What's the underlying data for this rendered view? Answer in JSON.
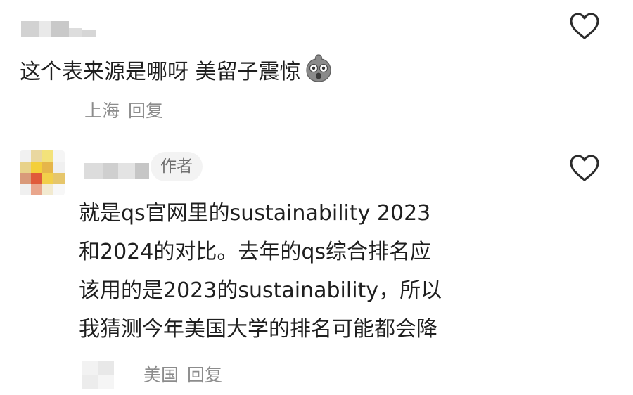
{
  "comments": [
    {
      "text": "这个表来源是哪呀 美留子震惊",
      "emoji_icon": "shocked-face-icon",
      "location": "上海",
      "reply_label": "回复"
    },
    {
      "badge": "作者",
      "lines": [
        "就是qs官网里的sustainability 2023",
        "和2024的对比。去年的qs综合排名应",
        "该用的是2023的sustainability，所以",
        "我猜测今年美国大学的排名可能都会降"
      ],
      "location": "美国",
      "reply_label": "回复"
    }
  ],
  "icons": {
    "like": "heart-outline-icon"
  },
  "colors": {
    "text": "#1f1f1f",
    "meta": "#8c8c8c",
    "badge_bg": "#f3f3f3"
  }
}
